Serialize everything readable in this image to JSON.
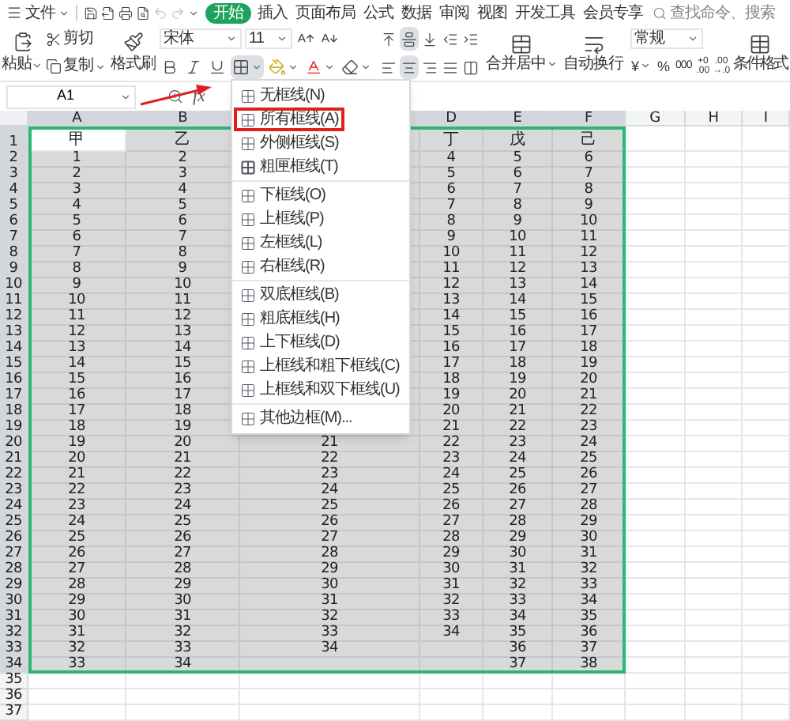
{
  "menu_bar": {
    "app_menu": "文件",
    "tabs": [
      {
        "label": "开始",
        "selected": true
      },
      {
        "label": "插入",
        "selected": false
      },
      {
        "label": "页面布局",
        "selected": false
      },
      {
        "label": "公式",
        "selected": false
      },
      {
        "label": "数据",
        "selected": false
      },
      {
        "label": "审阅",
        "selected": false
      },
      {
        "label": "视图",
        "selected": false
      },
      {
        "label": "开发工具",
        "selected": false
      },
      {
        "label": "会员专享",
        "selected": false
      }
    ],
    "search": {
      "placeholder": "查找命令、搜索"
    }
  },
  "ribbon": {
    "paste": "粘贴",
    "cut": "剪切",
    "copy": "复制",
    "format_painter": "格式刷",
    "font": "宋体",
    "font_size": "11",
    "merge_center": "合并居中",
    "wrap_text": "自动换行",
    "number_format": "常规",
    "currency": "¥",
    "percent": "%",
    "thousands": "000",
    "increase_decimal": [
      "+0",
      ".00"
    ],
    "decrease_decimal": [
      ".00",
      "→.0"
    ],
    "conditional_format": "条件格式"
  },
  "border_menu": {
    "groups": [
      {
        "items": [
          {
            "label": "无框线(N)",
            "highlighted": false
          },
          {
            "label": "所有框线(A)",
            "highlighted": true
          },
          {
            "label": "外侧框线(S)",
            "highlighted": false
          },
          {
            "label": "粗匣框线(T)",
            "highlighted": false
          }
        ]
      },
      {
        "items": [
          {
            "label": "下框线(O)",
            "highlighted": false
          },
          {
            "label": "上框线(P)",
            "highlighted": false
          },
          {
            "label": "左框线(L)",
            "highlighted": false
          },
          {
            "label": "右框线(R)",
            "highlighted": false
          }
        ]
      },
      {
        "items": [
          {
            "label": "双底框线(B)",
            "highlighted": false
          },
          {
            "label": "粗底框线(H)",
            "highlighted": false
          },
          {
            "label": "上下框线(D)",
            "highlighted": false
          },
          {
            "label": "上框线和粗下框线(C)",
            "highlighted": false
          },
          {
            "label": "上框线和双下框线(U)",
            "highlighted": false
          }
        ]
      },
      {
        "items": [
          {
            "label": "其他边框(M)...",
            "highlighted": false
          }
        ]
      }
    ]
  },
  "formula_bar": {
    "name_box": "A1",
    "function_label": "fx"
  },
  "sheet": {
    "columns": [
      {
        "label": "A",
        "selected": true
      },
      {
        "label": "B",
        "selected": true
      },
      {
        "selected": true
      },
      {
        "label": "D",
        "selected": true
      },
      {
        "label": "E",
        "selected": true
      },
      {
        "label": "F",
        "selected": true
      },
      {
        "label": "G",
        "selected": false
      },
      {
        "label": "H",
        "selected": false
      },
      {
        "label": "I",
        "selected": false
      }
    ],
    "rows": [
      {
        "number": "1",
        "selected": true,
        "cells": [
          {
            "text": "甲",
            "active": true
          },
          {
            "text": "乙",
            "active": false
          },
          null,
          {
            "text": "丁",
            "active": false
          },
          {
            "text": "戊",
            "active": false
          },
          {
            "text": "己",
            "active": false
          }
        ]
      },
      {
        "number": "2",
        "selected": true,
        "cells": [
          "1",
          "2",
          null,
          "4",
          "5",
          "6"
        ]
      },
      {
        "number": "3",
        "selected": true,
        "cells": [
          "2",
          "3",
          null,
          "5",
          "6",
          "7"
        ]
      },
      {
        "number": "4",
        "selected": true,
        "cells": [
          "3",
          "4",
          null,
          "6",
          "7",
          "8"
        ]
      },
      {
        "number": "5",
        "selected": true,
        "cells": [
          "4",
          "5",
          null,
          "7",
          "8",
          "9"
        ]
      },
      {
        "number": "6",
        "selected": true,
        "cells": [
          "5",
          "6",
          null,
          "8",
          "9",
          "10"
        ]
      },
      {
        "number": "7",
        "selected": true,
        "cells": [
          "6",
          "7",
          null,
          "9",
          "10",
          "11"
        ]
      },
      {
        "number": "8",
        "selected": true,
        "cells": [
          "7",
          "8",
          null,
          "10",
          "11",
          "12"
        ]
      },
      {
        "number": "9",
        "selected": true,
        "cells": [
          "8",
          "9",
          null,
          "11",
          "12",
          "13"
        ]
      },
      {
        "number": "10",
        "selected": true,
        "cells": [
          "9",
          "10",
          null,
          "12",
          "13",
          "14"
        ]
      },
      {
        "number": "11",
        "selected": true,
        "cells": [
          "10",
          "11",
          null,
          "13",
          "14",
          "15"
        ]
      },
      {
        "number": "12",
        "selected": true,
        "cells": [
          "11",
          "12",
          null,
          "14",
          "15",
          "16"
        ]
      },
      {
        "number": "13",
        "selected": true,
        "cells": [
          "12",
          "13",
          null,
          "15",
          "16",
          "17"
        ]
      },
      {
        "number": "14",
        "selected": true,
        "cells": [
          "13",
          "14",
          null,
          "16",
          "17",
          "18"
        ]
      },
      {
        "number": "15",
        "selected": true,
        "cells": [
          "14",
          "15",
          null,
          "17",
          "18",
          "19"
        ]
      },
      {
        "number": "16",
        "selected": true,
        "cells": [
          "15",
          "16",
          null,
          "18",
          "19",
          "20"
        ]
      },
      {
        "number": "17",
        "selected": true,
        "cells": [
          "16",
          "17",
          null,
          "19",
          "20",
          "21"
        ]
      },
      {
        "number": "18",
        "selected": true,
        "cells": [
          "17",
          "18",
          null,
          "20",
          "21",
          "22"
        ]
      },
      {
        "number": "19",
        "selected": true,
        "cells": [
          "18",
          "19",
          null,
          "21",
          "22",
          "23"
        ]
      },
      {
        "number": "20",
        "selected": true,
        "cells": [
          "19",
          "20",
          "21",
          "22",
          "23",
          "24"
        ]
      },
      {
        "number": "21",
        "selected": true,
        "cells": [
          "20",
          "21",
          "22",
          "23",
          "24",
          "25"
        ]
      },
      {
        "number": "22",
        "selected": true,
        "cells": [
          "21",
          "22",
          "23",
          "24",
          "25",
          "26"
        ]
      },
      {
        "number": "23",
        "selected": true,
        "cells": [
          "22",
          "23",
          "24",
          "25",
          "26",
          "27"
        ]
      },
      {
        "number": "24",
        "selected": true,
        "cells": [
          "23",
          "24",
          "25",
          "26",
          "27",
          "28"
        ]
      },
      {
        "number": "25",
        "selected": true,
        "cells": [
          "24",
          "25",
          "26",
          "27",
          "28",
          "29"
        ]
      },
      {
        "number": "26",
        "selected": true,
        "cells": [
          "25",
          "26",
          "27",
          "28",
          "29",
          "30"
        ]
      },
      {
        "number": "27",
        "selected": true,
        "cells": [
          "26",
          "27",
          "28",
          "29",
          "30",
          "31"
        ]
      },
      {
        "number": "28",
        "selected": true,
        "cells": [
          "27",
          "28",
          "29",
          "30",
          "31",
          "32"
        ]
      },
      {
        "number": "29",
        "selected": true,
        "cells": [
          "28",
          "29",
          "30",
          "31",
          "32",
          "33"
        ]
      },
      {
        "number": "30",
        "selected": true,
        "cells": [
          "29",
          "30",
          "31",
          "32",
          "33",
          "34"
        ]
      },
      {
        "number": "31",
        "selected": true,
        "cells": [
          "30",
          "31",
          "32",
          "33",
          "34",
          "35"
        ]
      },
      {
        "number": "32",
        "selected": true,
        "cells": [
          "31",
          "32",
          "33",
          "34",
          "35",
          "36"
        ]
      },
      {
        "number": "33",
        "selected": true,
        "cells": [
          "32",
          "33",
          "34",
          null,
          "36",
          "37"
        ]
      },
      {
        "number": "34",
        "selected": true,
        "cells": [
          "33",
          "34",
          null,
          null,
          "37",
          "38"
        ]
      },
      {
        "number": "35",
        "selected": false
      },
      {
        "number": "36",
        "selected": false
      },
      {
        "number": "37",
        "selected": false
      }
    ]
  }
}
